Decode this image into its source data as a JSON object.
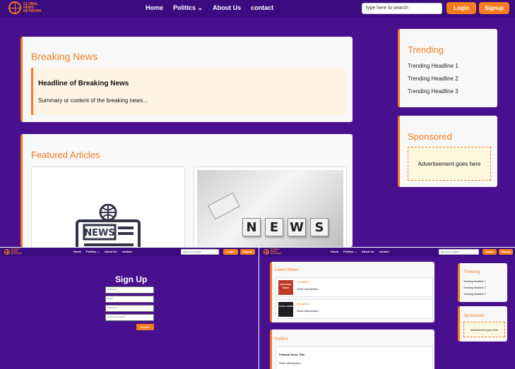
{
  "nav": {
    "logo_text": "GLOBAL\nNEWS\nNETWORK",
    "links": [
      "Home",
      "Politics ⌄",
      "About Us",
      "contact"
    ],
    "search_placeholder": "type here to search",
    "login_label": "Login",
    "signup_label": "Signup"
  },
  "main": {
    "breaking": {
      "title": "Breaking News",
      "headline": "Headline of Breaking News",
      "summary": "Summary or content of the breaking news..."
    },
    "featured": {
      "title": "Featured Articles",
      "icon_label": "NEWS",
      "photo_letters": [
        "N",
        "E",
        "W",
        "S"
      ]
    },
    "trending": {
      "title": "Trending",
      "items": [
        "Trending Headline 1",
        "Trending Headline 2",
        "Trending Headline 3"
      ]
    },
    "sponsored": {
      "title": "Sponsored",
      "ad_text": "Advertisement goes here"
    }
  },
  "signup_page": {
    "title": "Sign Up",
    "fields": [
      "Username",
      "Email",
      "Password",
      "Confirm Password"
    ],
    "register_label": "Register"
  },
  "news_page": {
    "latest": {
      "title": "Latest News",
      "items": [
        {
          "thumb": "BREAKING NEWS",
          "headline": "Headline 1",
          "desc": "Short description..."
        },
        {
          "thumb": "LOCAL NEWS",
          "headline": "Headline 2",
          "desc": "Short description..."
        }
      ]
    },
    "politics": {
      "title": "Politics",
      "news_title": "Political News Title",
      "desc": "Short description..."
    },
    "trending": {
      "title": "Trending",
      "items": [
        "Trending Headline 1",
        "Trending Headline 2",
        "Trending Headline 3"
      ]
    },
    "sponsored": {
      "title": "Sponsored",
      "ad_text": "Advertisement goes here"
    }
  },
  "colors": {
    "background": "#48108f",
    "navbar": "#3b0c80",
    "accent": "#f47c20",
    "card": "#f8f8f8"
  }
}
